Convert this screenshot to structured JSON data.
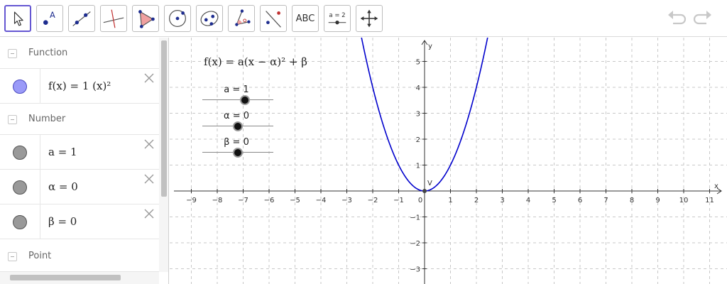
{
  "toolbar": {
    "tools": [
      {
        "name": "move-tool",
        "icon": "arrow-cursor-icon"
      },
      {
        "name": "point-tool",
        "icon": "point-a-icon",
        "label": "A"
      },
      {
        "name": "line-tool",
        "icon": "line-icon"
      },
      {
        "name": "perpendicular-tool",
        "icon": "perpendicular-line-icon"
      },
      {
        "name": "polygon-tool",
        "icon": "polygon-icon"
      },
      {
        "name": "circle-tool",
        "icon": "circle-center-icon"
      },
      {
        "name": "ellipse-tool",
        "icon": "ellipse-icon"
      },
      {
        "name": "angle-tool",
        "icon": "angle-icon"
      },
      {
        "name": "reflect-tool",
        "icon": "reflect-icon"
      },
      {
        "name": "text-tool",
        "icon": "text-icon",
        "label": "ABC"
      },
      {
        "name": "slider-tool",
        "icon": "slider-icon",
        "label": "a = 2"
      },
      {
        "name": "move-graphics-tool",
        "icon": "move-arrows-icon"
      }
    ],
    "active_tool": "move-tool"
  },
  "algebra": {
    "groups": [
      {
        "label": "Function"
      },
      {
        "label": "Number"
      },
      {
        "label": "Point"
      }
    ],
    "items": [
      {
        "expr": "f(x) = 1 (x)²",
        "color": "#9a9af8",
        "group": "Function"
      },
      {
        "expr": "a = 1",
        "color": "#9b9b9b",
        "group": "Number"
      },
      {
        "expr": "α = 0",
        "color": "#9b9b9b",
        "group": "Number"
      },
      {
        "expr": "β = 0",
        "color": "#9b9b9b",
        "group": "Number"
      }
    ]
  },
  "graphics": {
    "formula": "f(x) = a(x − α)² + β",
    "sliders": [
      {
        "label": "a = 1",
        "value": 1,
        "min": -5,
        "max": 5
      },
      {
        "label": "α = 0",
        "value": 0,
        "min": -5,
        "max": 5
      },
      {
        "label": "β = 0",
        "value": 0,
        "min": -5,
        "max": 5
      }
    ],
    "x_axis_label": "x",
    "y_axis_label": "y",
    "x_ticks": [
      "−9",
      "−8",
      "−7",
      "−6",
      "−5",
      "−4",
      "−3",
      "−2",
      "−1",
      "0",
      "1",
      "2",
      "3",
      "4",
      "5",
      "6",
      "7",
      "8",
      "9",
      "10",
      "11"
    ],
    "y_ticks": [
      "5",
      "4",
      "3",
      "2",
      "1",
      "−1",
      "−2",
      "−3"
    ],
    "vertex_label": "V",
    "curve_color": "#0000cc"
  }
}
